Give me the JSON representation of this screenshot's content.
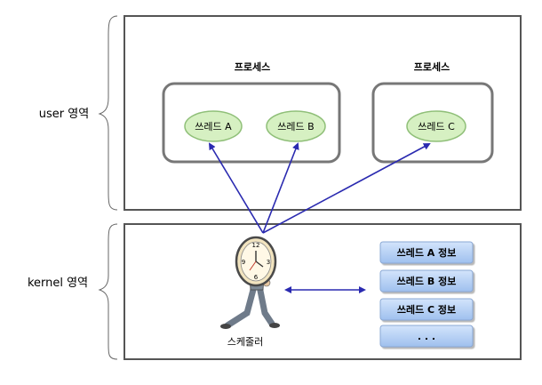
{
  "regions": {
    "user": "user 영역",
    "kernel": "kernel 영역"
  },
  "processes": [
    {
      "label": "프로세스",
      "threads": [
        "쓰레드 A",
        "쓰레드 B"
      ]
    },
    {
      "label": "프로세스",
      "threads": [
        "쓰레드 C"
      ]
    }
  ],
  "scheduler": {
    "label": "스케줄러"
  },
  "thread_info": [
    "쓰레드 A 정보",
    "쓰레드 B 정보",
    "쓰레드 C 정보",
    ". . ."
  ],
  "colors": {
    "thread_fill": "#d6f0c2",
    "thread_stroke": "#8fbf78",
    "process_stroke": "#777777",
    "arrow": "#2a2ab0",
    "info_fill": "#b9d3f5",
    "info_stroke": "#8aa8d4"
  }
}
